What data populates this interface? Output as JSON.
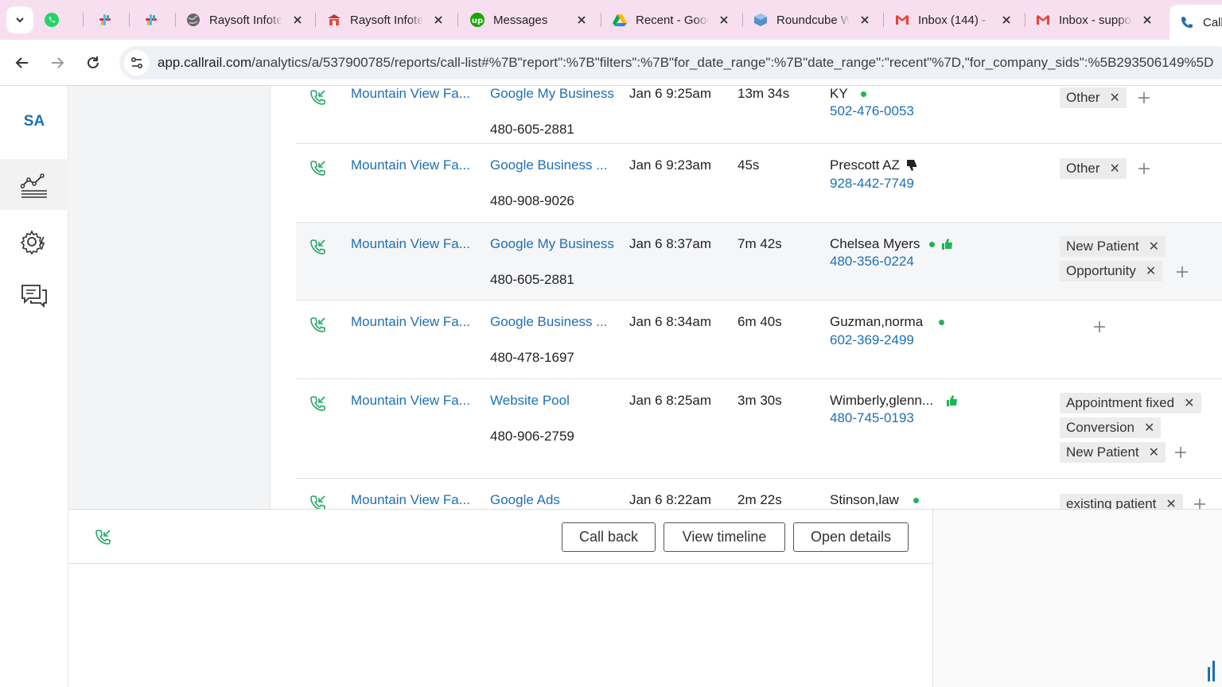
{
  "browser": {
    "tabs": [
      {
        "icon": "whatsapp-icon",
        "title": ""
      },
      {
        "icon": "slack-icon",
        "title": ""
      },
      {
        "icon": "slack-icon",
        "title": ""
      },
      {
        "icon": "globe-icon",
        "title": "Raysoft Infotech"
      },
      {
        "icon": "raysoft-icon",
        "title": "Raysoft Infotech"
      },
      {
        "icon": "upwork-icon",
        "title": "Messages"
      },
      {
        "icon": "google-drive-icon",
        "title": "Recent - Google Drive"
      },
      {
        "icon": "roundcube-icon",
        "title": "Roundcube Webmail"
      },
      {
        "icon": "gmail-icon",
        "title": "Inbox (144) -"
      },
      {
        "icon": "gmail-icon",
        "title": "Inbox - support"
      },
      {
        "icon": "callrail-icon",
        "title": "Call"
      }
    ],
    "url_host": "app.callrail.com",
    "url_path": "/analytics/a/537900785/reports/call-list#%7B\"report\":%7B\"filters\":%7B\"for_date_range\":%7B\"date_range\":\"recent\"%7D,\"for_company_sids\":%5B293506149%5D"
  },
  "rail": {
    "initials": "SA",
    "items": [
      "analytics-icon",
      "settings-icon",
      "messages-icon"
    ]
  },
  "calls": [
    {
      "company": "Mountain View Fa...",
      "source": "Google My Business",
      "tracking_number": "480-605-2881",
      "date": "Jan 6 9:25am",
      "duration": "13m 34s",
      "caller": "KY",
      "caller_number": "502-476-0053",
      "indicators": [
        "dot"
      ],
      "tags": [
        "Other"
      ]
    },
    {
      "company": "Mountain View Fa...",
      "source": "Google Business ...",
      "tracking_number": "480-908-9026",
      "date": "Jan 6 9:23am",
      "duration": "45s",
      "caller": "Prescott AZ",
      "caller_number": "928-442-7749",
      "indicators": [
        "thumb-down"
      ],
      "tags": [
        "Other"
      ]
    },
    {
      "company": "Mountain View Fa...",
      "source": "Google My Business",
      "tracking_number": "480-605-2881",
      "date": "Jan 6 8:37am",
      "duration": "7m 42s",
      "caller": "Chelsea Myers",
      "caller_number": "480-356-0224",
      "indicators": [
        "dot",
        "thumb-up"
      ],
      "tags": [
        "New Patient",
        "Opportunity"
      ]
    },
    {
      "company": "Mountain View Fa...",
      "source": "Google Business ...",
      "tracking_number": "480-478-1697",
      "date": "Jan 6 8:34am",
      "duration": "6m 40s",
      "caller": "Guzman,norma",
      "caller_number": "602-369-2499",
      "indicators": [
        "dot"
      ],
      "tags": []
    },
    {
      "company": "Mountain View Fa...",
      "source": "Website Pool",
      "tracking_number": "480-906-2759",
      "date": "Jan 6 8:25am",
      "duration": "3m 30s",
      "caller": "Wimberly,glenn...",
      "caller_number": "480-745-0193",
      "indicators": [
        "thumb-up"
      ],
      "tags": [
        "Appointment fixed",
        "Conversion",
        "New Patient"
      ]
    },
    {
      "company": "Mountain View Fa...",
      "source": "Google Ads",
      "tracking_number": "",
      "date": "Jan 6 8:22am",
      "duration": "2m 22s",
      "caller": "Stinson,law",
      "caller_number": "",
      "indicators": [
        "dot"
      ],
      "tags": [
        "existing patient"
      ]
    }
  ],
  "detail_panel": {
    "call_back": "Call back",
    "view_timeline": "View timeline",
    "open_details": "Open details"
  },
  "colors": {
    "link": "#1e6fb5",
    "green": "#1fb454",
    "tabbar": "#f7dff0"
  }
}
